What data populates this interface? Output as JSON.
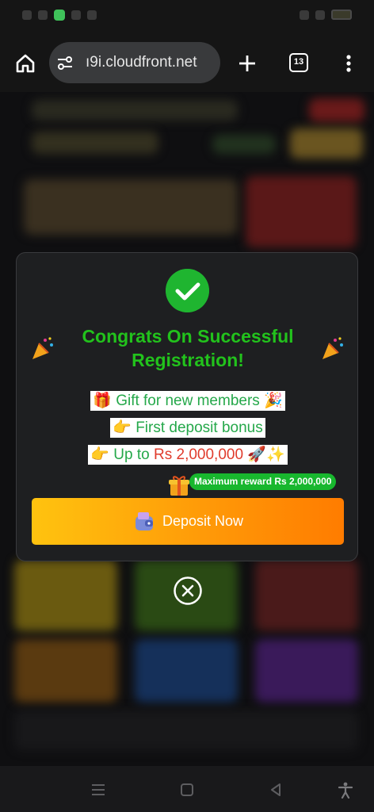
{
  "browser": {
    "url": "ı9i.cloudfront.net",
    "tab_count": "13"
  },
  "modal": {
    "title": "Congrats On Successful Registration!",
    "line1_emoji": "🎁",
    "line1_text": "Gift for new members",
    "line1_trail": "🎉",
    "line2_emoji": "👉",
    "line2_text": "First deposit bonus",
    "line3_emoji": "👉",
    "line3_text_a": "Up to",
    "line3_text_b": "Rs 2,000,000",
    "line3_trail": "🚀✨",
    "max_reward": "Maximum reward Rs 2,000,000",
    "deposit_label": "Deposit Now"
  },
  "colors": {
    "success_green": "#1fb530",
    "title_green": "#22c21c",
    "accent_orange": "#ff9a08",
    "amount_red": "#e03b2c"
  }
}
